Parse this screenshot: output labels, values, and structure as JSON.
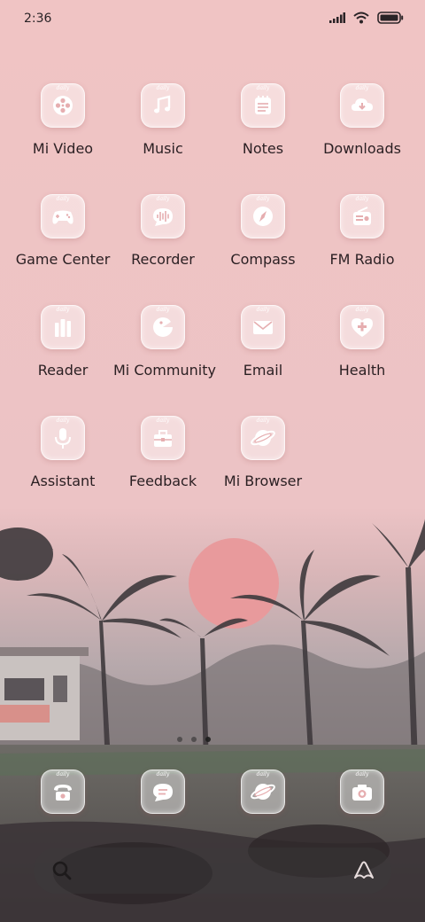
{
  "status_bar": {
    "time": "2:36"
  },
  "apps": [
    {
      "label": "Mi Video",
      "icon": "film-reel-icon"
    },
    {
      "label": "Music",
      "icon": "music-note-icon"
    },
    {
      "label": "Notes",
      "icon": "notepad-icon"
    },
    {
      "label": "Downloads",
      "icon": "cloud-download-icon"
    },
    {
      "label": "Game Center",
      "icon": "gamepad-icon"
    },
    {
      "label": "Recorder",
      "icon": "audio-wave-icon"
    },
    {
      "label": "Compass",
      "icon": "compass-icon"
    },
    {
      "label": "FM Radio",
      "icon": "radio-icon"
    },
    {
      "label": "Reader",
      "icon": "books-icon"
    },
    {
      "label": "Mi Community",
      "icon": "community-icon"
    },
    {
      "label": "Email",
      "icon": "envelope-icon"
    },
    {
      "label": "Health",
      "icon": "health-cross-icon"
    },
    {
      "label": "Assistant",
      "icon": "microphone-icon"
    },
    {
      "label": "Feedback",
      "icon": "toolbox-icon"
    },
    {
      "label": "Mi Browser",
      "icon": "planet-icon"
    }
  ],
  "dock": [
    {
      "label": "Phone",
      "icon": "telephone-icon"
    },
    {
      "label": "Messaging",
      "icon": "chat-bubble-icon"
    },
    {
      "label": "Browser",
      "icon": "planet-icon"
    },
    {
      "label": "Camera",
      "icon": "camera-icon"
    }
  ],
  "theme_brand": "daily",
  "pages": {
    "count": 3,
    "current": 3
  }
}
